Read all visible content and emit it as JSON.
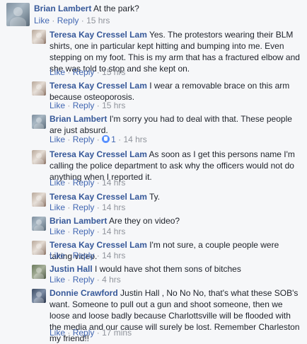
{
  "actions": {
    "like": "Like",
    "reply": "Reply",
    "sep": "·"
  },
  "comments": [
    {
      "author": "Brian Lambert",
      "text": "At the park?",
      "time": "15 hrs"
    },
    {
      "author": "Teresa Kay Cressel Lam",
      "text": "Yes. The protestors wearing their BLM shirts, one in particular kept hitting and bumping into me. Even stepping on my foot. This is my arm that has a fractured elbow and she was told to stop and she kept on.",
      "time": "15 hrs"
    },
    {
      "author": "Teresa Kay Cressel Lam",
      "text": "I wear a removable brace on this arm because osteoporosis.",
      "time": "15 hrs"
    },
    {
      "author": "Brian Lambert",
      "text": "I'm sorry you had to deal with that. These people are just absurd.",
      "time": "14 hrs",
      "reactions": "1"
    },
    {
      "author": "Teresa Kay Cressel Lam",
      "text": "As soon as I get this persons name I'm calling the police department to ask why the officers would not do anything when I reported it.",
      "time": "14 hrs"
    },
    {
      "author": "Teresa Kay Cressel Lam",
      "text": "Ty.",
      "time": "14 hrs"
    },
    {
      "author": "Brian Lambert",
      "text": "Are they on video?",
      "time": "14 hrs"
    },
    {
      "author": "Teresa Kay Cressel Lam",
      "text": "I'm not sure, a couple people were taking video.",
      "time": "14 hrs"
    },
    {
      "author": "Justin Hall",
      "text": "I would have shot them sons of bitches",
      "time": "4 hrs"
    },
    {
      "author": "Donnie Crawford",
      "text": "Justin Hall , No No No, that's what these SOB's want. Someone to pull out a gun and shoot someone, then we loose and loose badly because Charlottsville will be flooded with the media and our cause will surely be lost. Remember Charleston my friend!!",
      "time": "17 mins"
    }
  ]
}
